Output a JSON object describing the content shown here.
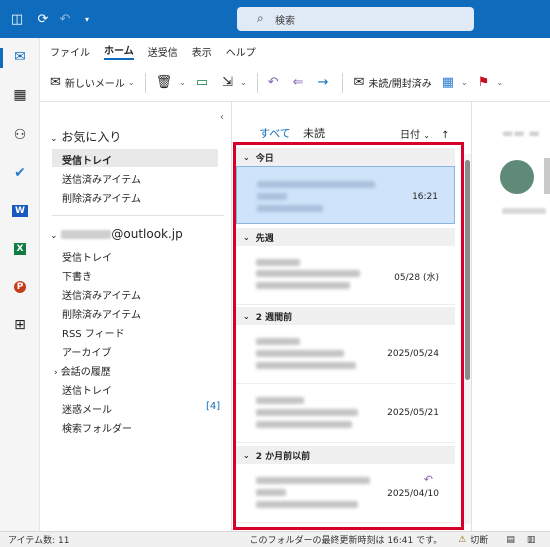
{
  "titlebar": {
    "search_placeholder": "検索"
  },
  "menu": {
    "items": [
      "ファイル",
      "ホーム",
      "送受信",
      "表示",
      "ヘルプ"
    ],
    "active": "ホーム"
  },
  "ribbon": {
    "new_mail": "新しいメール",
    "read_unread": "未読/開封済み"
  },
  "folders": {
    "favorites_header": "お気に入り",
    "favorites": [
      "受信トレイ",
      "送信済みアイテム",
      "削除済みアイテム"
    ],
    "account_domain": "@outlook.jp",
    "account_folders": [
      "受信トレイ",
      "下書き",
      "送信済みアイテム",
      "削除済みアイテム",
      "RSS フィード",
      "アーカイブ",
      "会話の履歴",
      "送信トレイ",
      "迷惑メール",
      "検索フォルダー"
    ],
    "junk_count": "[4]"
  },
  "list": {
    "tab_all": "すべて",
    "tab_unread": "未読",
    "sort_label": "日付",
    "sections": [
      "今日",
      "先週",
      "2 週間前",
      "2 か月前以前"
    ],
    "times": [
      "16:21",
      "05/28 (水)",
      "2025/05/24",
      "2025/05/21",
      "2025/04/10"
    ]
  },
  "status": {
    "item_count": "アイテム数: 11",
    "last_update": "このフォルダーの最終更新時刻は 16:41 です。",
    "offline": "切断"
  },
  "colors": {
    "accent": "#0f6cbd",
    "highlight_frame": "#d6002a",
    "selection": "#cfe4fa"
  }
}
